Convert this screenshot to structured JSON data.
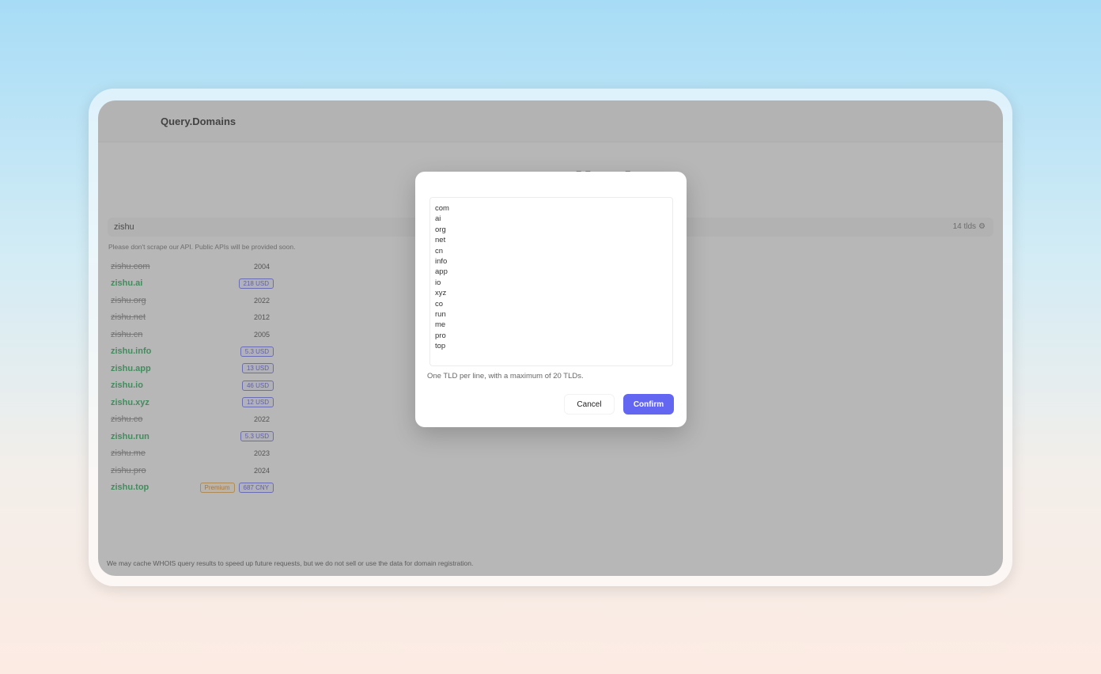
{
  "app": {
    "brand": "Query.Domains",
    "hero_title": "Fas     lled"
  },
  "search": {
    "value": "zishu",
    "tld_count": "14 tlds"
  },
  "notice": "Please don't scrape our API. Public APIs will be provided soon.",
  "results": [
    {
      "domain": "zishu.com",
      "status": "taken",
      "year": "2004",
      "badges": []
    },
    {
      "domain": "zishu.ai",
      "status": "available",
      "year": "",
      "badges": [
        {
          "text": "218 USD",
          "kind": "price"
        }
      ]
    },
    {
      "domain": "zishu.org",
      "status": "taken",
      "year": "2022",
      "badges": []
    },
    {
      "domain": "zishu.net",
      "status": "taken",
      "year": "2012",
      "badges": []
    },
    {
      "domain": "zishu.cn",
      "status": "taken",
      "year": "2005",
      "badges": []
    },
    {
      "domain": "zishu.info",
      "status": "available",
      "year": "",
      "badges": [
        {
          "text": "5.3 USD",
          "kind": "price"
        }
      ]
    },
    {
      "domain": "zishu.app",
      "status": "available",
      "year": "",
      "badges": [
        {
          "text": "13 USD",
          "kind": "price"
        }
      ]
    },
    {
      "domain": "zishu.io",
      "status": "available",
      "year": "",
      "badges": [
        {
          "text": "46 USD",
          "kind": "price"
        }
      ]
    },
    {
      "domain": "zishu.xyz",
      "status": "available",
      "year": "",
      "badges": [
        {
          "text": "12 USD",
          "kind": "price"
        }
      ]
    },
    {
      "domain": "zishu.co",
      "status": "taken",
      "year": "2022",
      "badges": []
    },
    {
      "domain": "zishu.run",
      "status": "available",
      "year": "",
      "badges": [
        {
          "text": "5.3 USD",
          "kind": "price"
        }
      ]
    },
    {
      "domain": "zishu.me",
      "status": "taken",
      "year": "2023",
      "badges": []
    },
    {
      "domain": "zishu.pro",
      "status": "taken",
      "year": "2024",
      "badges": []
    },
    {
      "domain": "zishu.top",
      "status": "available",
      "year": "",
      "badges": [
        {
          "text": "Premium",
          "kind": "premium"
        },
        {
          "text": "687 CNY",
          "kind": "price"
        }
      ]
    }
  ],
  "footer_note": "We may cache WHOIS query results to speed up future requests, but we do not sell or use the data for domain registration.",
  "modal": {
    "tlds": [
      "com",
      "ai",
      "org",
      "net",
      "cn",
      "info",
      "app",
      "io",
      "xyz",
      "co",
      "run",
      "me",
      "pro",
      "top"
    ],
    "helper": "One TLD per line, with a maximum of 20 TLDs.",
    "cancel_label": "Cancel",
    "confirm_label": "Confirm"
  },
  "colors": {
    "accent": "#6366f1",
    "available": "#16a34a",
    "taken": "#777777",
    "premium": "#d97706"
  },
  "icons": {
    "settings": "gear-icon"
  }
}
